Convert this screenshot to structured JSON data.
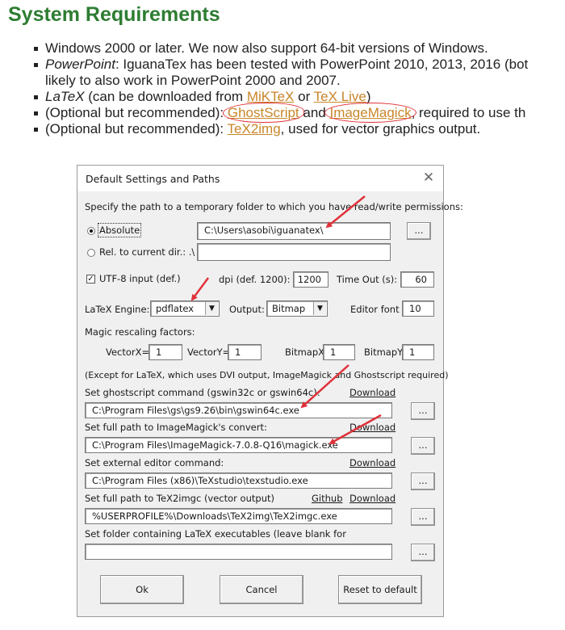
{
  "page": {
    "heading": "System Requirements",
    "requirements": {
      "item1": "Windows 2000 or later. We now also support 64-bit versions of Windows.",
      "item2_em": "PowerPoint",
      "item2_text": ": IguanaTex has been tested with PowerPoint 2010, 2013, 2016 (bot",
      "item2_cont": "likely to also work in PowerPoint 2000 and 2007.",
      "item3_em": "LaTeX",
      "item3_text": " (can be downloaded from ",
      "item3_link1": "MiKTeX",
      "item3_or": " or ",
      "item3_link2": "TeX Live",
      "item3_end": ")",
      "item4_text": "(Optional but recommended): ",
      "item4_link1": "GhostScript",
      "item4_and": " and ",
      "item4_link2": "ImageMagick",
      "item4_end": ", required to use th",
      "item5_text": "(Optional but recommended): ",
      "item5_link": "TeX2img",
      "item5_end": ", used for vector graphics output."
    }
  },
  "dialog": {
    "title": "Default Settings and Paths",
    "close_glyph": "✕",
    "temp_prompt": "Specify the path to a temporary folder to which you have read/write permissions:",
    "absolute_label": "Absolute",
    "absolute_value": "C:\\Users\\asobi\\iguanatex\\",
    "relative_label": "Rel. to current dir.: .\\",
    "relative_value": "",
    "browse_label": "...",
    "utf8_label": "UTF-8 input (def.)",
    "utf8_checked_glyph": "✓",
    "dpi_label": "dpi (def. 1200):",
    "dpi_value": "1200",
    "timeout_label": "Time Out (s):",
    "timeout_value": "60",
    "engine_label": "LaTeX Engine:",
    "engine_value": "pdflatex",
    "output_label": "Output:",
    "output_value": "Bitmap",
    "editor_font_label": "Editor font",
    "editor_font_value": "10",
    "dropdown_glyph": "▼",
    "magic_label": "Magic rescaling factors:",
    "vectorx_label": "VectorX=",
    "vectorx_value": "1",
    "vectory_label": "VectorY=",
    "vectory_value": "1",
    "bitmapx_label": "BitmapX",
    "bitmapx_value": "1",
    "bitmapy_label": "BitmapY",
    "bitmapy_value": "1",
    "except_note": "(Except for LaTeX, which uses DVI output, ImageMagick and Ghostscript required)",
    "gs_label": "Set ghostscript command (gswin32c or gswin64c):",
    "gs_download": "Download",
    "gs_value": "C:\\Program Files\\gs\\gs9.26\\bin\\gswin64c.exe",
    "im_label": "Set full path to ImageMagick's convert:",
    "im_download": "Download",
    "im_value": "C:\\Program Files\\ImageMagick-7.0.8-Q16\\magick.exe",
    "editor_label": "Set external editor command:",
    "editor_download": "Download",
    "editor_value": "C:\\Program Files (x86)\\TeXstudio\\texstudio.exe",
    "tex2img_label": "Set full path to TeX2imgc (vector output)",
    "tex2img_github": "Github",
    "tex2img_download": "Download",
    "tex2img_value": "%USERPROFILE%\\Downloads\\TeX2img\\TeX2imgc.exe",
    "latex_folder_label": "Set folder containing LaTeX executables (leave blank for",
    "latex_folder_value": "",
    "ok_label": "Ok",
    "cancel_label": "Cancel",
    "reset_label": "Reset to default"
  },
  "colors": {
    "heading": "#2e7d32",
    "link": "#c8862a",
    "annotation_red": "#e0313a"
  }
}
